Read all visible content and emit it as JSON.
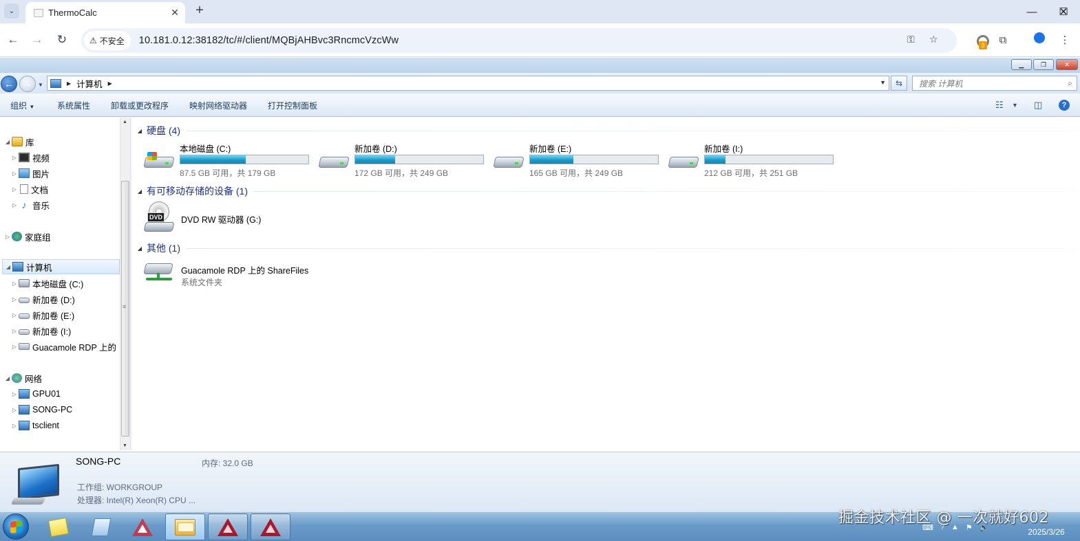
{
  "browser": {
    "tab_title": "ThermoCalc",
    "security_label": "不安全",
    "url": "10.181.0.12:38182/tc/#/client/MQBjAHBvc3RncmcVzcWw",
    "extension_badge": "3"
  },
  "explorer": {
    "address": {
      "crumb": "计算机",
      "search_placeholder": "搜索 计算机"
    },
    "commands": [
      "组织",
      "系统属性",
      "卸载或更改程序",
      "映射网络驱动器",
      "打开控制面板"
    ],
    "nav": {
      "libraries": "库",
      "videos": "视频",
      "pictures": "图片",
      "documents": "文档",
      "music": "音乐",
      "homegroup": "家庭组",
      "computer": "计算机",
      "drive_c": "本地磁盘 (C:)",
      "drive_d": "新加卷 (D:)",
      "drive_e": "新加卷 (E:)",
      "drive_i": "新加卷 (I:)",
      "guac": "Guacamole RDP 上的",
      "network": "网络",
      "gpu01": "GPU01",
      "song_pc": "SONG-PC",
      "tsclient": "tsclient"
    },
    "groups": {
      "hdd": "硬盘 (4)",
      "removable": "有可移动存储的设备 (1)",
      "other": "其他 (1)"
    },
    "drives": [
      {
        "name": "本地磁盘 (C:)",
        "free": "87.5 GB 可用，共 179 GB",
        "used_fraction": 0.51
      },
      {
        "name": "新加卷 (D:)",
        "free": "172 GB 可用，共 249 GB",
        "used_fraction": 0.31
      },
      {
        "name": "新加卷 (E:)",
        "free": "165 GB 可用，共 249 GB",
        "used_fraction": 0.34
      },
      {
        "name": "新加卷 (I:)",
        "free": "212 GB 可用，共 251 GB",
        "used_fraction": 0.16
      }
    ],
    "dvd": {
      "name": "DVD RW 驱动器 (G:)",
      "badge": "DVD"
    },
    "share": {
      "name": "Guacamole RDP 上的 ShareFiles",
      "type": "系统文件夹"
    },
    "details": {
      "name": "SONG-PC",
      "memory": "内存: 32.0 GB",
      "workgroup": "工作组: WORKGROUP",
      "cpu": "处理器: Intel(R) Xeon(R) CPU ..."
    }
  },
  "taskbar": {
    "date": "2025/3/26"
  },
  "watermark": "掘金技术社区 @ 一次就好602"
}
